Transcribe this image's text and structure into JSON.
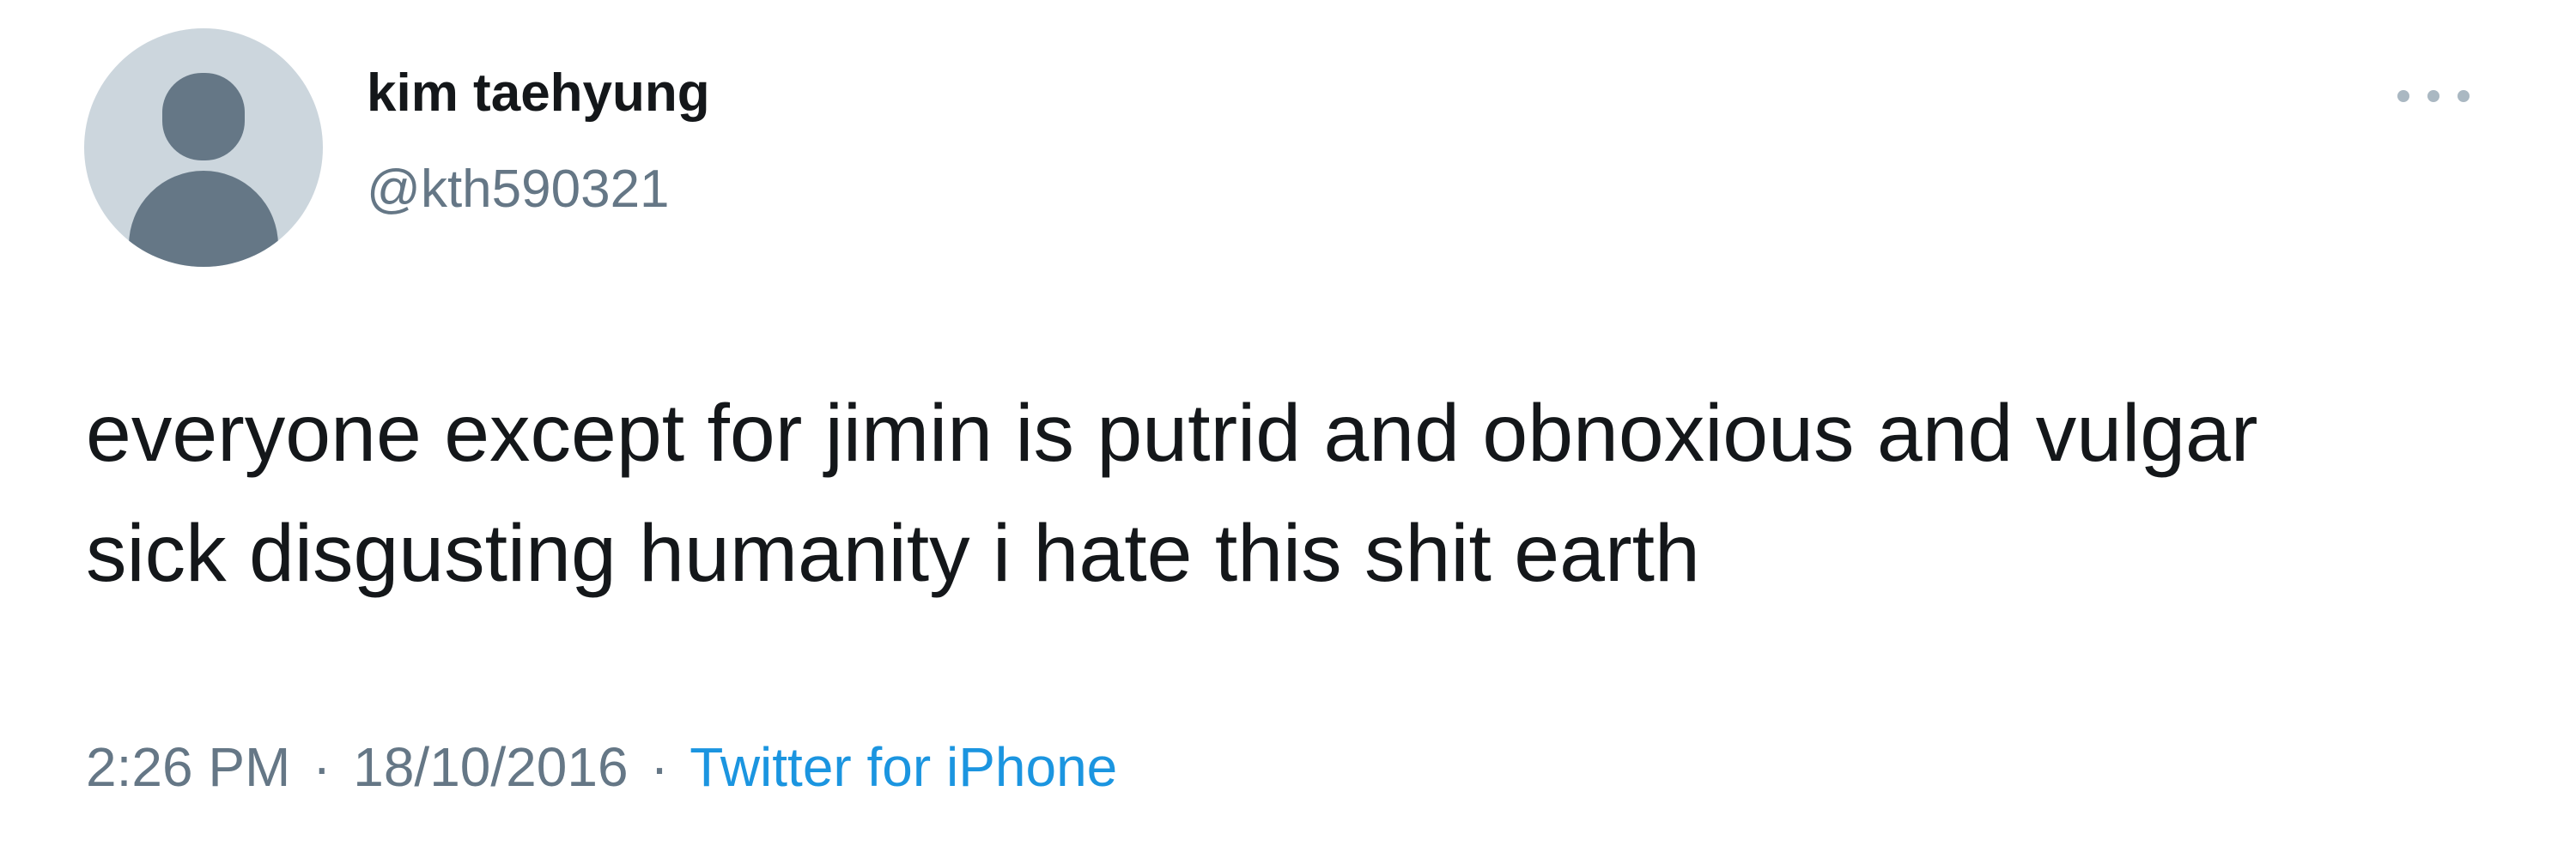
{
  "tweet": {
    "avatar_icon": "default-profile-icon",
    "display_name": "kim taehyung",
    "handle": "@kth590321",
    "more_icon": "more-horizontal-icon",
    "text": "everyone except for jimin is putrid and obnoxious and vulgar\nsick disgusting humanity i hate this shit earth",
    "time": "2:26 PM",
    "date": "18/10/2016",
    "separator": "·",
    "source": "Twitter for iPhone"
  },
  "colors": {
    "text_primary": "#14171a",
    "text_secondary": "#657786",
    "link": "#1b95e0",
    "avatar_bg": "#ccd6dd",
    "avatar_silhouette": "#657786"
  }
}
